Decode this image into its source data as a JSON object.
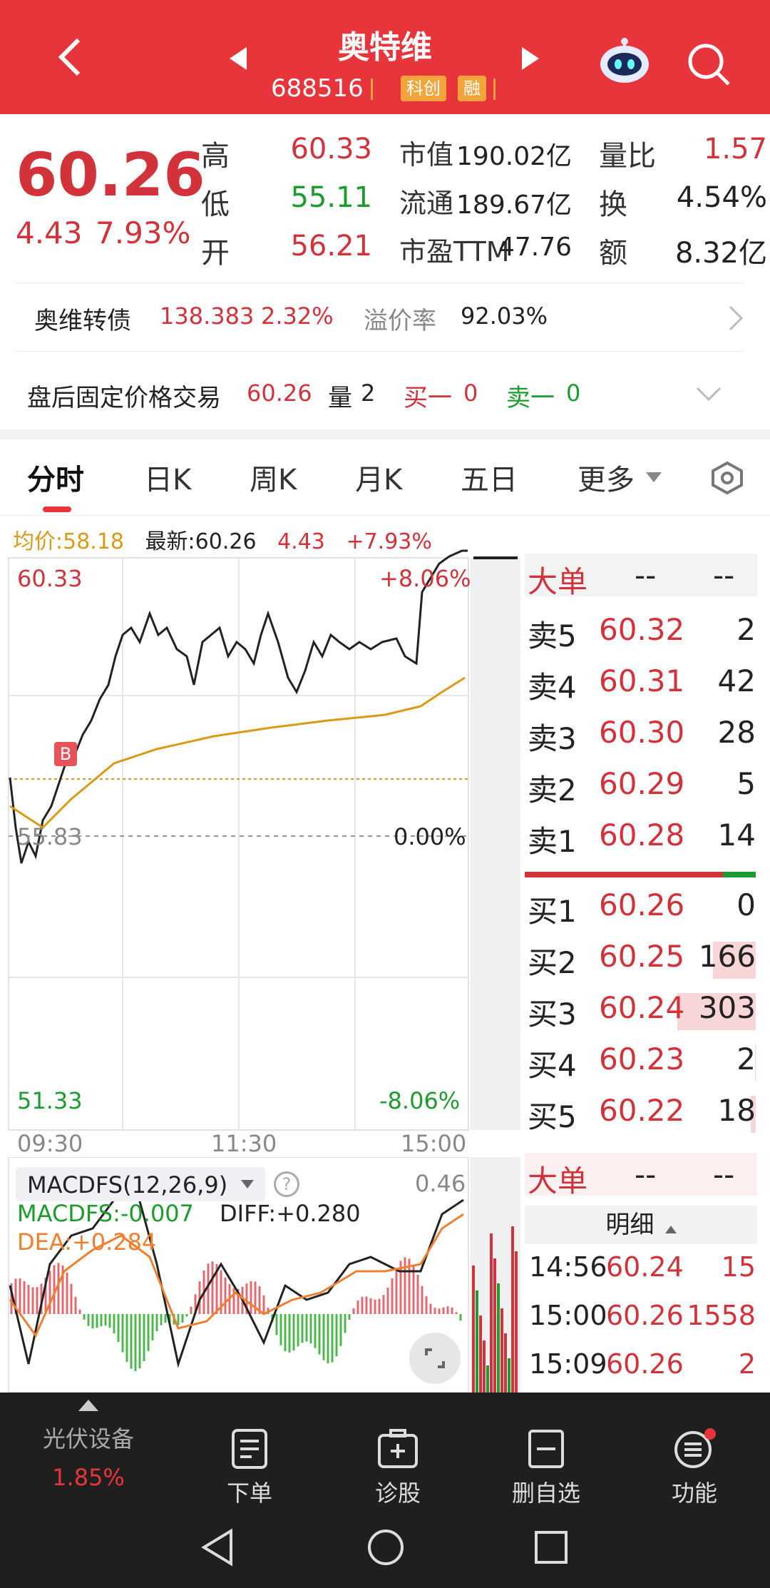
{
  "header": {
    "title": "奥特维",
    "code": "688516",
    "tag1": "科创",
    "tag2": "融"
  },
  "quote": {
    "price": "60.26",
    "change": "4.43",
    "pct": "7.93%",
    "rows": [
      {
        "l1": "高",
        "v1": "60.33",
        "l2": "市值",
        "v2": "190.02亿",
        "l3": "量比",
        "v3": "1.57"
      },
      {
        "l1": "低",
        "v1": "55.11",
        "l2": "流通",
        "v2": "189.67亿",
        "l3": "换",
        "v3": "4.54%"
      },
      {
        "l1": "开",
        "v1": "56.21",
        "l2": "市盈TTM",
        "v2": "47.76",
        "l3": "额",
        "v3": "8.32亿"
      }
    ]
  },
  "bond": {
    "name": "奥维转债",
    "price": "138.383",
    "pct": "2.32%",
    "premium_label": "溢价率",
    "premium": "92.03%"
  },
  "after_hours": {
    "label": "盘后固定价格交易",
    "price": "60.26",
    "vol_label": "量",
    "vol": "2",
    "buy_label": "买一",
    "buy": "0",
    "sell_label": "卖一",
    "sell": "0"
  },
  "tabs": [
    "分时",
    "日K",
    "周K",
    "月K",
    "五日",
    "更多"
  ],
  "intraday": {
    "avg_label": "均价:",
    "avg": "58.18",
    "latest_label": "最新:",
    "latest": "60.26",
    "chg": "4.43",
    "pct": "+7.93%",
    "top": "60.33",
    "top_pct": "+8.06%",
    "mid": "55.83",
    "mid_pct": "0.00%",
    "bot": "51.33",
    "bot_pct": "-8.06%",
    "t1": "09:30",
    "t2": "11:30",
    "t3": "15:00",
    "marker": "B"
  },
  "macd": {
    "name": "MACDFS(12,26,9)",
    "macd": "MACDFS:-0.007",
    "diff": "DIFF:+0.280",
    "dea": "DEA:+0.284",
    "val": "0.46"
  },
  "orderbook": {
    "big_label": "大单",
    "dash": "--",
    "sells": [
      {
        "l": "卖5",
        "p": "60.32",
        "v": "2"
      },
      {
        "l": "卖4",
        "p": "60.31",
        "v": "42"
      },
      {
        "l": "卖3",
        "p": "60.30",
        "v": "28"
      },
      {
        "l": "卖2",
        "p": "60.29",
        "v": "5"
      },
      {
        "l": "卖1",
        "p": "60.28",
        "v": "14"
      }
    ],
    "buys": [
      {
        "l": "买1",
        "p": "60.26",
        "v": "0"
      },
      {
        "l": "买2",
        "p": "60.25",
        "v": "166"
      },
      {
        "l": "买3",
        "p": "60.24",
        "v": "303"
      },
      {
        "l": "买4",
        "p": "60.23",
        "v": "2"
      },
      {
        "l": "买5",
        "p": "60.22",
        "v": "18"
      }
    ]
  },
  "detail": {
    "label": "明细",
    "rows": [
      {
        "t": "14:56",
        "p": "60.24",
        "v": "15"
      },
      {
        "t": "15:00",
        "p": "60.26",
        "v": "1558"
      },
      {
        "t": "15:09",
        "p": "60.26",
        "v": "2"
      }
    ]
  },
  "bottom_nav": {
    "sector": "光伏设备",
    "sector_pct": "1.85%",
    "items": [
      "下单",
      "诊股",
      "删自选",
      "功能"
    ]
  },
  "colors": {
    "up": "#d2323a",
    "down": "#1c9c2f",
    "header": "#e8353b",
    "avg": "#d99a18"
  }
}
